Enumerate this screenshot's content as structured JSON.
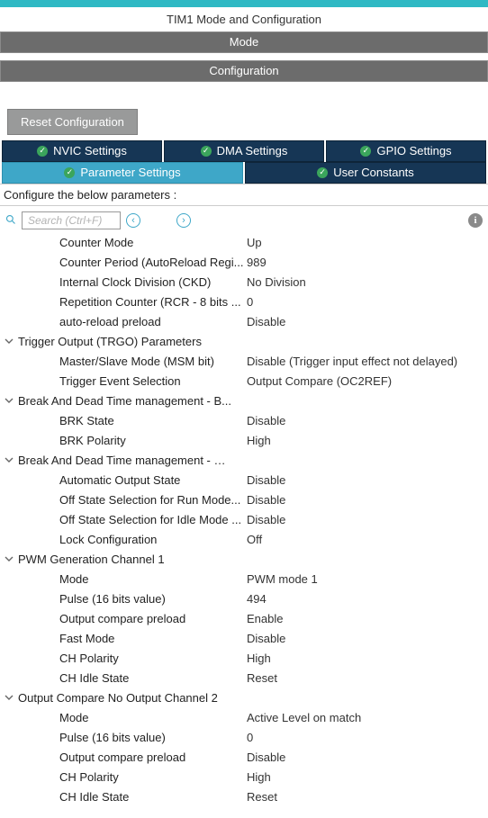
{
  "title": "TIM1 Mode and Configuration",
  "mode_label": "Mode",
  "config_label": "Configuration",
  "reset_label": "Reset Configuration",
  "tabs": {
    "nvic": "NVIC Settings",
    "dma": "DMA Settings",
    "gpio": "GPIO Settings",
    "param": "Parameter Settings",
    "user": "User Constants"
  },
  "configure_line": "Configure the below parameters :",
  "search": {
    "placeholder": "Search (Ctrl+F)"
  },
  "rows_top": [
    {
      "label": "Counter Mode",
      "value": "Up"
    },
    {
      "label": "Counter Period (AutoReload Regi...",
      "value": "989"
    },
    {
      "label": "Internal Clock Division (CKD)",
      "value": "No Division"
    },
    {
      "label": "Repetition Counter (RCR - 8 bits ...",
      "value": "0"
    },
    {
      "label": "auto-reload preload",
      "value": "Disable"
    }
  ],
  "groups": [
    {
      "title": "Trigger Output (TRGO) Parameters",
      "items": [
        {
          "label": "Master/Slave Mode (MSM bit)",
          "value": "Disable (Trigger input effect not delayed)"
        },
        {
          "label": "Trigger Event Selection",
          "value": "Output Compare (OC2REF)"
        }
      ]
    },
    {
      "title": "Break And Dead Time management - B...",
      "items": [
        {
          "label": "BRK State",
          "value": "Disable"
        },
        {
          "label": "BRK Polarity",
          "value": "High"
        }
      ]
    },
    {
      "title": "Break And Dead Time management - Ou...",
      "items": [
        {
          "label": "Automatic Output State",
          "value": "Disable"
        },
        {
          "label": "Off State Selection for Run Mode...",
          "value": "Disable"
        },
        {
          "label": "Off State Selection for Idle Mode ...",
          "value": "Disable"
        },
        {
          "label": "Lock Configuration",
          "value": "Off"
        }
      ]
    },
    {
      "title": "PWM Generation Channel 1",
      "items": [
        {
          "label": "Mode",
          "value": "PWM mode 1"
        },
        {
          "label": "Pulse (16 bits value)",
          "value": "494"
        },
        {
          "label": "Output compare preload",
          "value": "Enable"
        },
        {
          "label": "Fast Mode",
          "value": "Disable"
        },
        {
          "label": "CH Polarity",
          "value": "High"
        },
        {
          "label": "CH Idle State",
          "value": "Reset"
        }
      ]
    },
    {
      "title": "Output Compare No Output Channel 2",
      "items": [
        {
          "label": "Mode",
          "value": "Active Level on match"
        },
        {
          "label": "Pulse (16 bits value)",
          "value": "0"
        },
        {
          "label": "Output compare preload",
          "value": "Disable"
        },
        {
          "label": "CH Polarity",
          "value": "High"
        },
        {
          "label": "CH Idle State",
          "value": "Reset"
        }
      ]
    }
  ]
}
